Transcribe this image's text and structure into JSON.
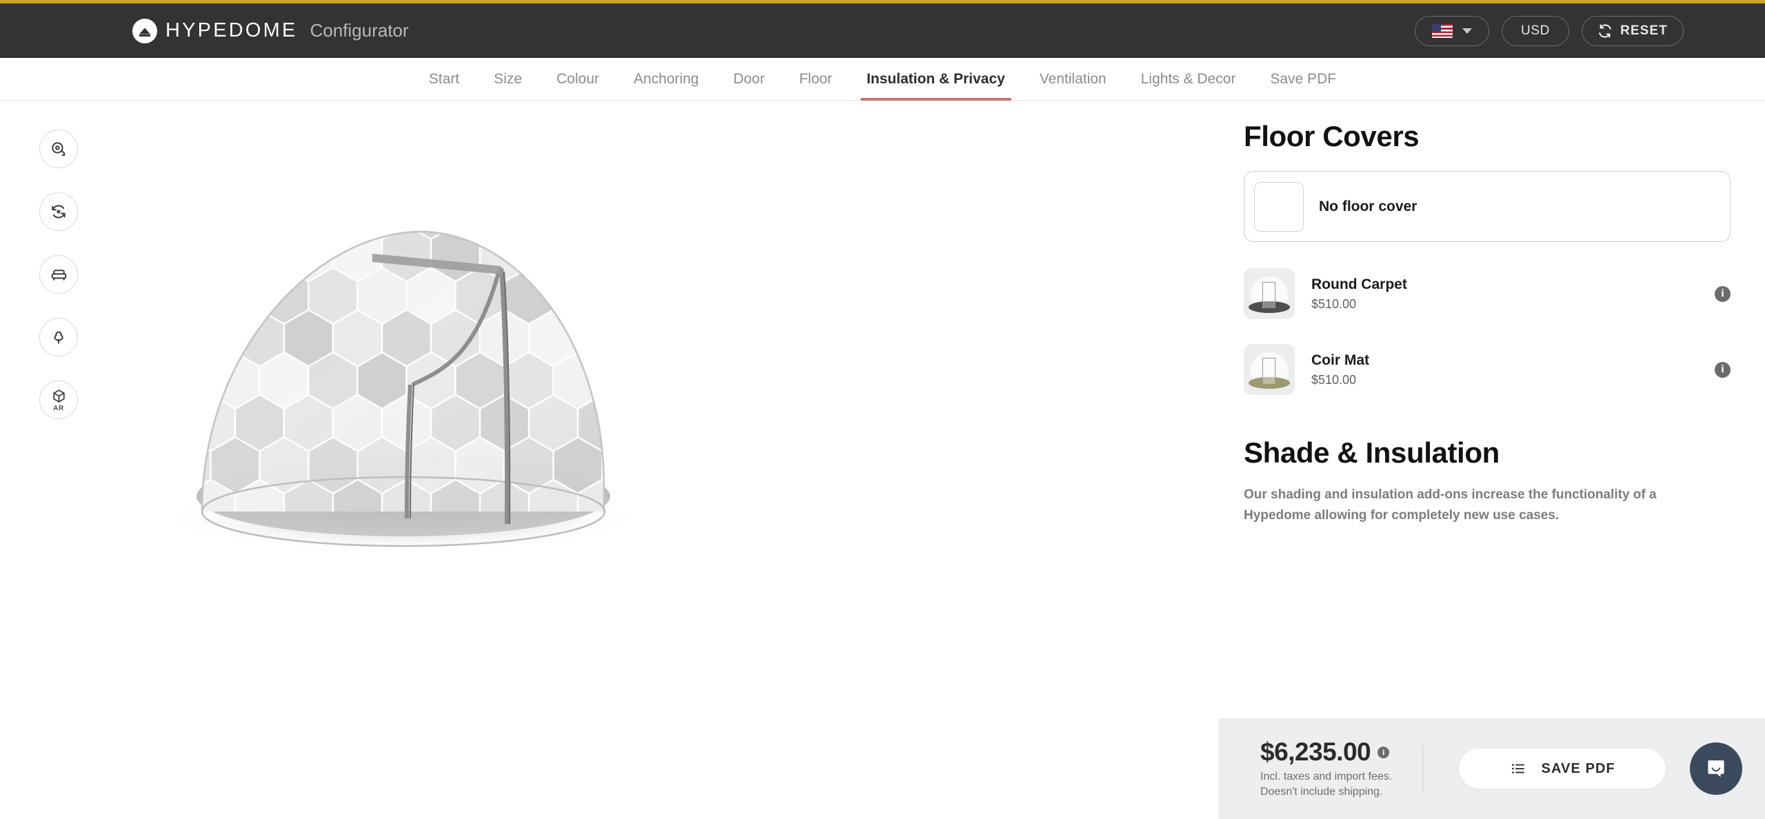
{
  "theme": {
    "accent_gold": "#c9a227",
    "header_bg": "#333334",
    "active_tab_underline": "#c9766e",
    "pricebar_bg": "#eceef0",
    "chat_bubble_bg": "#3b4a5c"
  },
  "header": {
    "brand_name": "HYPEDOME",
    "brand_subtitle": "Configurator",
    "logo_icon": "hypedome-logo-icon",
    "country_selector": {
      "icon": "us-flag-icon",
      "caret_icon": "chevron-down-icon"
    },
    "currency_label": "USD",
    "reset_label": "RESET",
    "reset_icon": "refresh-icon"
  },
  "nav": {
    "tabs": [
      {
        "label": "Start",
        "active": false
      },
      {
        "label": "Size",
        "active": false
      },
      {
        "label": "Colour",
        "active": false
      },
      {
        "label": "Anchoring",
        "active": false
      },
      {
        "label": "Door",
        "active": false
      },
      {
        "label": "Floor",
        "active": false
      },
      {
        "label": "Insulation & Privacy",
        "active": true
      },
      {
        "label": "Ventilation",
        "active": false
      },
      {
        "label": "Lights & Decor",
        "active": false
      },
      {
        "label": "Save PDF",
        "active": false
      }
    ]
  },
  "viewer": {
    "tools": [
      {
        "name": "measure-tape-icon",
        "label": ""
      },
      {
        "name": "rotate-360-icon",
        "label": ""
      },
      {
        "name": "furniture-armchair-icon",
        "label": ""
      },
      {
        "name": "tree-landscape-icon",
        "label": ""
      },
      {
        "name": "ar-cube-icon",
        "label": "AR"
      }
    ],
    "model_alt": "3d-geodesic-dome-render"
  },
  "panel": {
    "floor_covers": {
      "title": "Floor Covers",
      "selected_option": {
        "label": "No floor cover",
        "thumb": "blank-swatch",
        "selected": true
      },
      "products": [
        {
          "name": "Round Carpet",
          "price": "$510.00",
          "thumb": "round-carpet-thumbnail",
          "floor_color": "#4e4e4e",
          "info_icon": "info-icon"
        },
        {
          "name": "Coir Mat",
          "price": "$510.00",
          "thumb": "coir-mat-thumbnail",
          "floor_color": "#9b9970",
          "info_icon": "info-icon"
        }
      ]
    },
    "shade_insulation": {
      "title": "Shade & Insulation",
      "description": "Our shading and insulation add-ons increase the functionality of a Hypedome allowing for completely new use cases."
    }
  },
  "pricebar": {
    "amount": "$6,235.00",
    "info_icon": "info-icon",
    "note_line1": "Incl. taxes and import fees.",
    "note_line2": "Doesn't include shipping.",
    "save_pdf_label": "SAVE PDF",
    "save_pdf_icon": "list-icon",
    "chat_icon": "chat-bubble-icon"
  }
}
